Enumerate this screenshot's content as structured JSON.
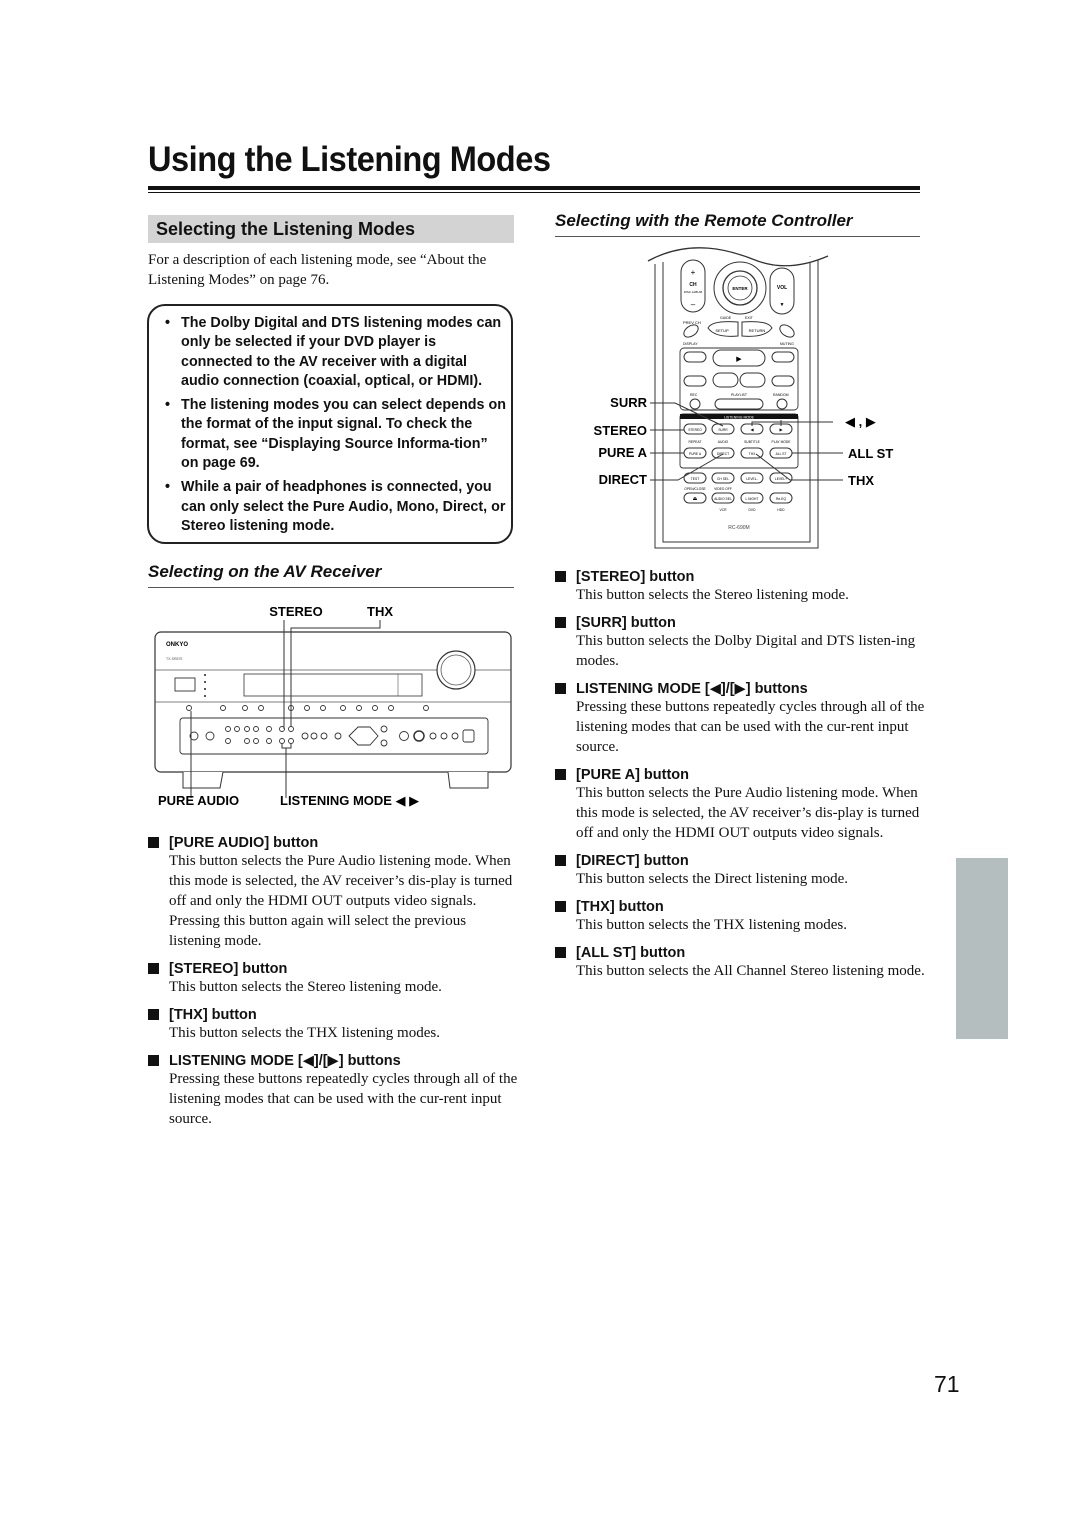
{
  "page": {
    "title": "Using the Listening Modes",
    "page_number": "71"
  },
  "section": {
    "heading": "Selecting the Listening Modes",
    "intro": "For a description of each listening mode, see “About the Listening Modes” on page 76.",
    "notes": [
      "The Dolby Digital and DTS listening modes can only be selected if your DVD player is connected to the AV receiver with a digital audio connection (coaxial, optical, or HDMI).",
      "The listening modes you can select depends on the format of the input signal. To check the format, see “Displaying Source Informa-tion” on page 69.",
      "While a pair of headphones is connected, you can only select the Pure Audio, Mono, Direct, or Stereo listening mode."
    ],
    "bullet_glyph": "•"
  },
  "av_receiver": {
    "heading": "Selecting on the AV Receiver",
    "callouts": {
      "stereo": "STEREO",
      "thx": "THX",
      "pure_audio": "PURE AUDIO",
      "listening_mode": "LISTENING MODE ◀ ▶"
    },
    "device_labels": {
      "brand": "ONKYO",
      "model": "TX-SR875"
    },
    "items": [
      {
        "title": "[PURE AUDIO] button",
        "body": "This button selects the Pure Audio listening mode. When this mode is selected, the AV receiver’s dis-play is turned off and only the HDMI OUT outputs video signals. Pressing this button again will select the previous listening mode."
      },
      {
        "title": "[STEREO] button",
        "body": "This button selects the Stereo listening mode."
      },
      {
        "title": "[THX] button",
        "body": "This button selects the THX listening modes."
      },
      {
        "title": "LISTENING MODE [◀]/[▶] buttons",
        "body": "Pressing these buttons repeatedly cycles through all of the listening modes that can be used with the cur-rent input source."
      }
    ]
  },
  "remote": {
    "heading": "Selecting with the Remote Controller",
    "callouts": {
      "surr": "SURR",
      "stereo": "STEREO",
      "pure_a": "PURE A",
      "direct": "DIRECT",
      "arrows": "◀ , ▶",
      "all_st": "ALL ST",
      "thx": "THX"
    },
    "device_labels": {
      "model": "RC-690M",
      "ch": "CH",
      "disc_album": "DISC ALBUM",
      "enter": "ENTER",
      "vol": "VOL",
      "guide": "GUIDE",
      "exit": "EXIT",
      "prev_ch": "PREV CH",
      "setup": "SETUP",
      "return": "RETURN",
      "display": "DISPLAY",
      "muting": "MUTING",
      "rec": "REC",
      "playlist": "PLAYLIST",
      "random": "RANDOM",
      "listening_mode": "LISTENING MODE",
      "stereo_btn": "STEREO",
      "surr_btn": "SURR",
      "repeat": "REPEAT",
      "audio": "AUDIO",
      "subtitle": "SUBTITLE",
      "play_mode": "PLAY MODE",
      "pure_a_btn": "PURE A",
      "direct_btn": "DIRECT",
      "thx_btn": "THX",
      "all_st_btn": "ALL ST",
      "test_tone": "TEST",
      "ch_sel": "CH SEL",
      "level_minus": "LEVEL-",
      "level_plus": "LEVEL+",
      "open_close": "OPEN/CLOSE",
      "video_off": "VIDEO OFF",
      "audio_sel": "AUDIO SEL",
      "l_night": "L NIGHT",
      "re_eq": "Re-EQ",
      "vcr": "VCR",
      "dvd": "DVD",
      "hdd": "HDD"
    },
    "items": [
      {
        "title": "[STEREO] button",
        "body": "This button selects the Stereo listening mode."
      },
      {
        "title": "[SURR] button",
        "body": "This button selects the Dolby Digital and DTS listen-ing modes."
      },
      {
        "title": "LISTENING MODE [◀]/[▶] buttons",
        "body": "Pressing these buttons repeatedly cycles through all of the listening modes that can be used with the cur-rent input source."
      },
      {
        "title": "[PURE A] button",
        "body": "This button selects the Pure Audio listening mode. When this mode is selected, the AV receiver’s dis-play is turned off and only the HDMI OUT outputs video signals."
      },
      {
        "title": "[DIRECT] button",
        "body": "This button selects the Direct listening mode."
      },
      {
        "title": "[THX] button",
        "body": "This button selects the THX listening modes."
      },
      {
        "title": "[ALL ST] button",
        "body": "This button selects the All Channel Stereo listening mode."
      }
    ]
  },
  "colors": {
    "section_band": "#d3d3d3",
    "side_tab": "#b4bebe",
    "text": "#111111"
  }
}
